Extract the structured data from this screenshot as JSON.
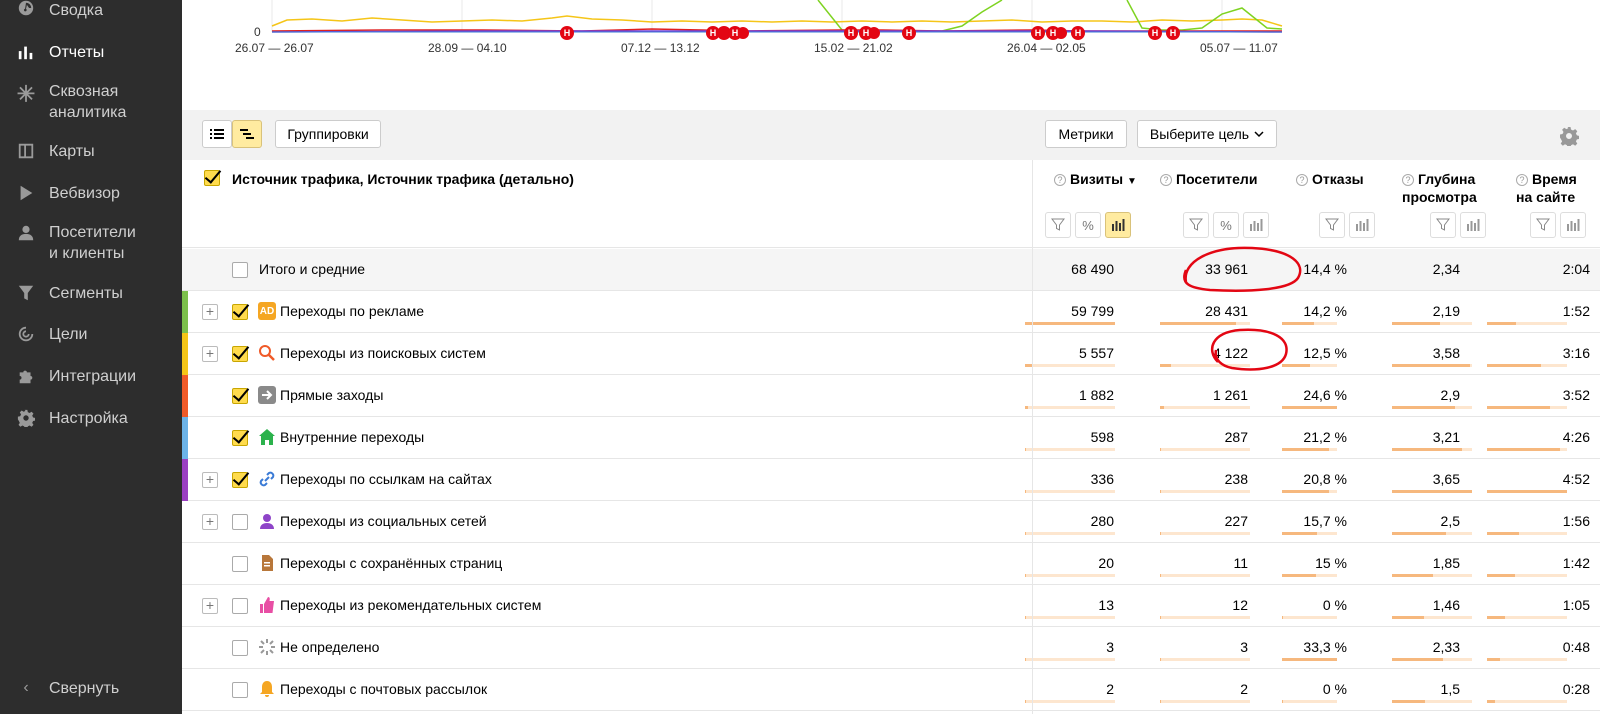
{
  "sidebar": {
    "items": [
      {
        "label": "Сводка",
        "icon": "dashboard-icon"
      },
      {
        "label": "Отчеты",
        "icon": "bar-chart-icon",
        "active": true
      },
      {
        "label": "Сквозная\nаналитика",
        "icon": "asterisk-icon"
      },
      {
        "label": "Карты",
        "icon": "map-icon"
      },
      {
        "label": "Вебвизор",
        "icon": "play-icon"
      },
      {
        "label": "Посетители\nи клиенты",
        "icon": "user-icon"
      },
      {
        "label": "Сегменты",
        "icon": "filter-icon"
      },
      {
        "label": "Цели",
        "icon": "target-icon"
      },
      {
        "label": "Интеграции",
        "icon": "puzzle-icon"
      },
      {
        "label": "Настройка",
        "icon": "gear-icon"
      }
    ],
    "collapse_label": "Свернуть"
  },
  "chart": {
    "y_tick": "0",
    "x_ticks": [
      "26.07 — 26.07",
      "28.09 — 04.10",
      "07.12 — 13.12",
      "15.02 — 21.02",
      "26.04 — 02.05",
      "05.07 — 11.07"
    ],
    "marker_letter": "Н",
    "colors": {
      "yellow": "#f5c518",
      "green": "#7ed321",
      "red": "#e02020",
      "purple": "#7b3fd6",
      "blue": "#3b7bd6"
    }
  },
  "toolbar": {
    "groupings_label": "Группировки",
    "metrics_label": "Метрики",
    "goal_label": "Выберите цель"
  },
  "header": {
    "dimension_label": "Источник трафика, Источник трафика (детально)",
    "columns": [
      {
        "label": "Визиты",
        "sort": "▼"
      },
      {
        "label": "Посетители"
      },
      {
        "label": "Отказы"
      },
      {
        "label": "Глубина\nпросмотра"
      },
      {
        "label": "Время\nна сайте"
      }
    ]
  },
  "total": {
    "label": "Итого и средние",
    "visits": "68 490",
    "visitors": "33 961",
    "bounce": "14,4 %",
    "depth": "2,34",
    "time": "2:04"
  },
  "rows": [
    {
      "label": "Переходы по рекламе",
      "color": "#7cc04c",
      "icon": "ad-icon",
      "expandable": true,
      "checked": true,
      "visits": "59 799",
      "visitors": "28 431",
      "bounce": "14,2 %",
      "depth": "2,19",
      "time": "1:52",
      "bars": [
        1.0,
        0.84,
        0.58,
        0.6,
        0.36
      ]
    },
    {
      "label": "Переходы из поисковых систем",
      "color": "#f5c518",
      "icon": "search-icon",
      "expandable": true,
      "checked": true,
      "visits": "5 557",
      "visitors": "4 122",
      "bounce": "12,5 %",
      "depth": "3,58",
      "time": "3:16",
      "bars": [
        0.09,
        0.12,
        0.51,
        0.98,
        0.67
      ]
    },
    {
      "label": "Прямые заходы",
      "color": "#f05a28",
      "icon": "direct-icon",
      "expandable": false,
      "checked": true,
      "visits": "1 882",
      "visitors": "1 261",
      "bounce": "24,6 %",
      "depth": "2,9",
      "time": "3:52",
      "bars": [
        0.03,
        0.04,
        1.0,
        0.79,
        0.79
      ]
    },
    {
      "label": "Внутренние переходы",
      "color": "#6cb3e8",
      "icon": "home-icon",
      "expandable": false,
      "checked": true,
      "visits": "598",
      "visitors": "287",
      "bounce": "21,2 %",
      "depth": "3,21",
      "time": "4:26",
      "bars": [
        0.01,
        0.01,
        0.86,
        0.88,
        0.91
      ]
    },
    {
      "label": "Переходы по ссылкам на сайтах",
      "color": "#9b3fc2",
      "icon": "link-icon",
      "expandable": true,
      "checked": true,
      "visits": "336",
      "visitors": "238",
      "bounce": "20,8 %",
      "depth": "3,65",
      "time": "4:52",
      "bars": [
        0.006,
        0.008,
        0.85,
        1.0,
        1.0
      ]
    },
    {
      "label": "Переходы из социальных сетей",
      "color": "",
      "icon": "social-icon",
      "expandable": true,
      "checked": false,
      "visits": "280",
      "visitors": "227",
      "bounce": "15,7 %",
      "depth": "2,5",
      "time": "1:56",
      "bars": [
        0.005,
        0.008,
        0.64,
        0.68,
        0.4
      ]
    },
    {
      "label": "Переходы с сохранённых страниц",
      "color": "",
      "icon": "page-icon",
      "expandable": false,
      "checked": false,
      "visits": "20",
      "visitors": "11",
      "bounce": "15 %",
      "depth": "1,85",
      "time": "1:42",
      "bars": [
        0.0,
        0.0,
        0.61,
        0.51,
        0.35
      ]
    },
    {
      "label": "Переходы из рекомендательных систем",
      "color": "",
      "icon": "thumbs-up-icon",
      "expandable": true,
      "checked": false,
      "visits": "13",
      "visitors": "12",
      "bounce": "0 %",
      "depth": "1,46",
      "time": "1:05",
      "bars": [
        0.0,
        0.0,
        0.0,
        0.4,
        0.22
      ]
    },
    {
      "label": "Не определено",
      "color": "",
      "icon": "spinner-icon",
      "expandable": false,
      "checked": false,
      "visits": "3",
      "visitors": "3",
      "bounce": "33,3 %",
      "depth": "2,33",
      "time": "0:48",
      "bars": [
        0.0,
        0.0,
        1.0,
        0.64,
        0.16
      ]
    },
    {
      "label": "Переходы с почтовых рассылок",
      "color": "",
      "icon": "bell-icon",
      "expandable": false,
      "checked": false,
      "visits": "2",
      "visitors": "2",
      "bounce": "0 %",
      "depth": "1,5",
      "time": "0:28",
      "bars": [
        0.0,
        0.0,
        0.0,
        0.41,
        0.1
      ]
    }
  ]
}
